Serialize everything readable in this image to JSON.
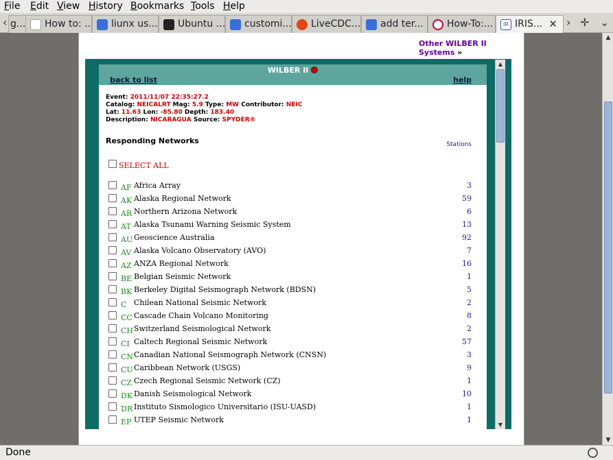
{
  "menu": [
    "File",
    "Edit",
    "View",
    "History",
    "Bookmarks",
    "Tools",
    "Help"
  ],
  "menu_mnemonics": [
    "F",
    "E",
    "V",
    "H",
    "B",
    "T",
    "H"
  ],
  "tabs": [
    {
      "label": "g...",
      "icon": "partial-tab-icon",
      "color": "#9a9a9a"
    },
    {
      "label": "How to: ...",
      "icon": "blank-page-icon",
      "color": "#ffffff"
    },
    {
      "label": "liunx us...",
      "icon": "google-icon",
      "color": "#3b6fd8"
    },
    {
      "label": "Ubuntu ...",
      "icon": "tux-penguin-icon",
      "color": "#222222"
    },
    {
      "label": "customi...",
      "icon": "google-icon",
      "color": "#3b6fd8"
    },
    {
      "label": "LiveCDC...",
      "icon": "ubuntu-icon",
      "color": "#dd4814"
    },
    {
      "label": "add ter...",
      "icon": "google-icon",
      "color": "#3b6fd8"
    },
    {
      "label": "How-To:...",
      "icon": "debian-swirl-icon",
      "color": "#c70036"
    },
    {
      "label": "IRIS...",
      "icon": "iris-icon",
      "color": "#3355aa",
      "active": true
    }
  ],
  "nav": {
    "back_glyph": "‹",
    "fwd_glyph": "›",
    "newtab_glyph": "✛",
    "menu_glyph": "⌄",
    "close_glyph": "✕"
  },
  "page": {
    "other_systems": "Other WILBER II Systems",
    "other_systems_arrow": "»",
    "logo": "WILBER II",
    "back_to_list": "back to list",
    "help": "help",
    "event": {
      "event_label": "Event:",
      "event_value": "2011/11/07 22:35:27.2",
      "catalog_label": "Catalog:",
      "catalog_value": "NEICALRT",
      "mag_label": "Mag:",
      "mag_value": "5.9",
      "type_label": "Type:",
      "type_value": "MW",
      "contributor_label": "Contributor:",
      "contributor_value": "NEIC",
      "lat_label": "Lat:",
      "lat_value": "11.63",
      "lon_label": "Lon:",
      "lon_value": "-85.80",
      "depth_label": "Depth:",
      "depth_value": "183.40",
      "desc_label": "Description:",
      "desc_value": "NICARAGUA",
      "source_label": "Source:",
      "source_value": "SPYDER®"
    },
    "responding_networks": "Responding Networks",
    "stations_header": "Stations",
    "select_all": "SELECT ALL",
    "networks": [
      {
        "code": "AF",
        "name": "Africa Array",
        "stations": "3"
      },
      {
        "code": "AK",
        "name": "Alaska Regional Network",
        "stations": "59"
      },
      {
        "code": "AR",
        "name": "Northern Arizona Network",
        "stations": "6"
      },
      {
        "code": "AT",
        "name": "Alaska Tsunami Warning Seismic System",
        "stations": "13"
      },
      {
        "code": "AU",
        "name": "Geoscience Australia",
        "stations": "92"
      },
      {
        "code": "AV",
        "name": "Alaska Volcano Observatory (AVO)",
        "stations": "7"
      },
      {
        "code": "AZ",
        "name": "ANZA Regional Network",
        "stations": "16"
      },
      {
        "code": "BE",
        "name": "Belgian Seismic Network",
        "stations": "1"
      },
      {
        "code": "BK",
        "name": "Berkeley Digital Seismograph Network (BDSN)",
        "stations": "5"
      },
      {
        "code": "C",
        "name": "Chilean National Seismic Network",
        "stations": "2"
      },
      {
        "code": "CC",
        "name": "Cascade Chain Volcano Monitoring",
        "stations": "8"
      },
      {
        "code": "CH",
        "name": "Switzerland Seismological Network",
        "stations": "2"
      },
      {
        "code": "CI",
        "name": "Caltech Regional Seismic Network",
        "stations": "57"
      },
      {
        "code": "CN",
        "name": "Canadian National Seismograph Network (CNSN)",
        "stations": "3"
      },
      {
        "code": "CU",
        "name": "Caribbean Network (USGS)",
        "stations": "9"
      },
      {
        "code": "CZ",
        "name": "Czech Regional Seismic Network (CZ)",
        "stations": "1"
      },
      {
        "code": "DK",
        "name": "Danish Seismological Network",
        "stations": "10"
      },
      {
        "code": "DR",
        "name": "Instituto Sismologico Universitario (ISU-UASD)",
        "stations": "1"
      },
      {
        "code": "EP",
        "name": "UTEP Seismic Network",
        "stations": "1"
      }
    ]
  },
  "status": "Done",
  "colors": {
    "frame": "#0e6b66",
    "banner": "#5ea59e",
    "code": "#1a8a1a",
    "event_value": "#cc0000",
    "link": "#660099"
  }
}
